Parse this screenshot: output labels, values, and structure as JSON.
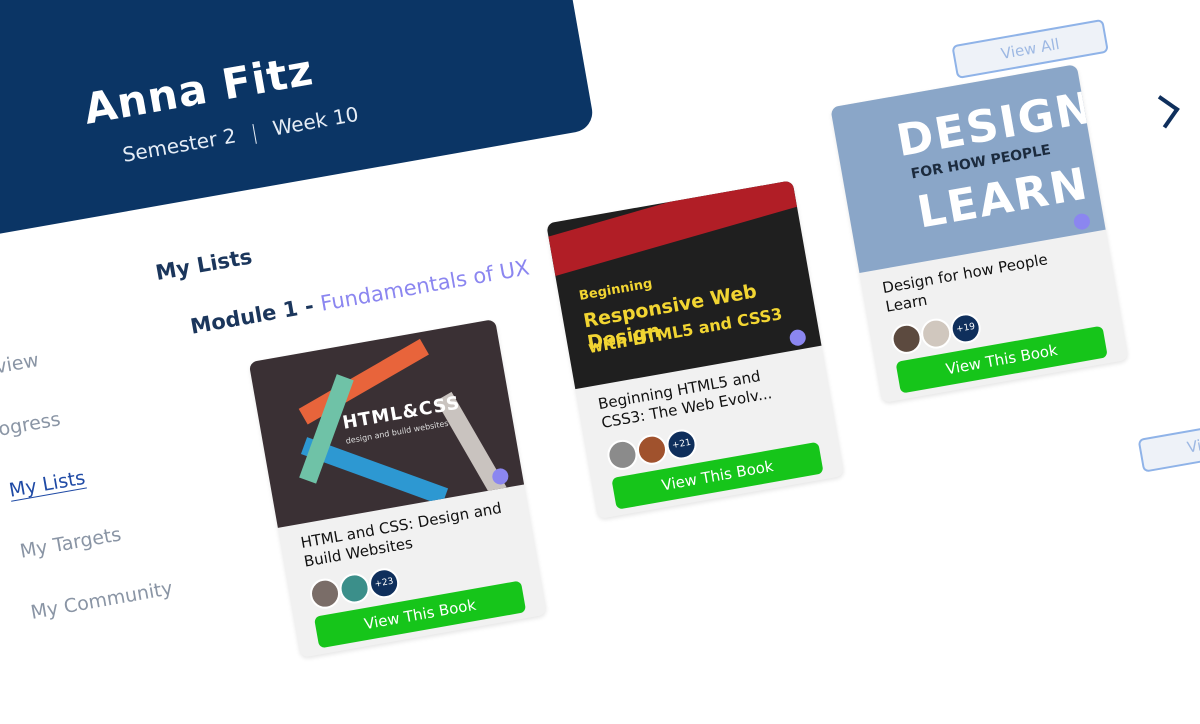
{
  "header": {
    "name": "Anna Fitz",
    "semester": "Semester 2",
    "week": "Week 10"
  },
  "nav": {
    "items": [
      {
        "label": "rview"
      },
      {
        "label": "ogress"
      },
      {
        "label": "My Lists"
      },
      {
        "label": "My Targets"
      },
      {
        "label": "My Community"
      }
    ]
  },
  "main": {
    "section_title": "My Lists",
    "module_prefix": "Module 1 - ",
    "module_name": "Fundamentals of UX",
    "view_all_top": "View All",
    "view_all_bottom": "View All"
  },
  "cards": [
    {
      "title": "HTML and CSS: Design and Build Websites",
      "cover_title": "HTML&CSS",
      "cover_subtitle": "design and build websites",
      "more_count": "+23",
      "button_label": "View This Book"
    },
    {
      "title": "Beginning HTML5 and CSS3: The Web Evolv...",
      "cover_line1": "Beginning",
      "cover_line2": "Responsive Web Design",
      "cover_line3": "with HTML5 and CSS3",
      "more_count": "+21",
      "button_label": "View This Book"
    },
    {
      "title": "Design for how People Learn",
      "cover_line1": "DESIGN",
      "cover_line2": "FOR HOW PEOPLE",
      "cover_line3": "LEARN",
      "more_count": "+19",
      "button_label": "View This Book"
    }
  ],
  "colors": {
    "header_bg": "#0b3565",
    "accent_purple": "#8b86f0",
    "button_green": "#16c51a",
    "nav_active": "#1f4aa5"
  }
}
